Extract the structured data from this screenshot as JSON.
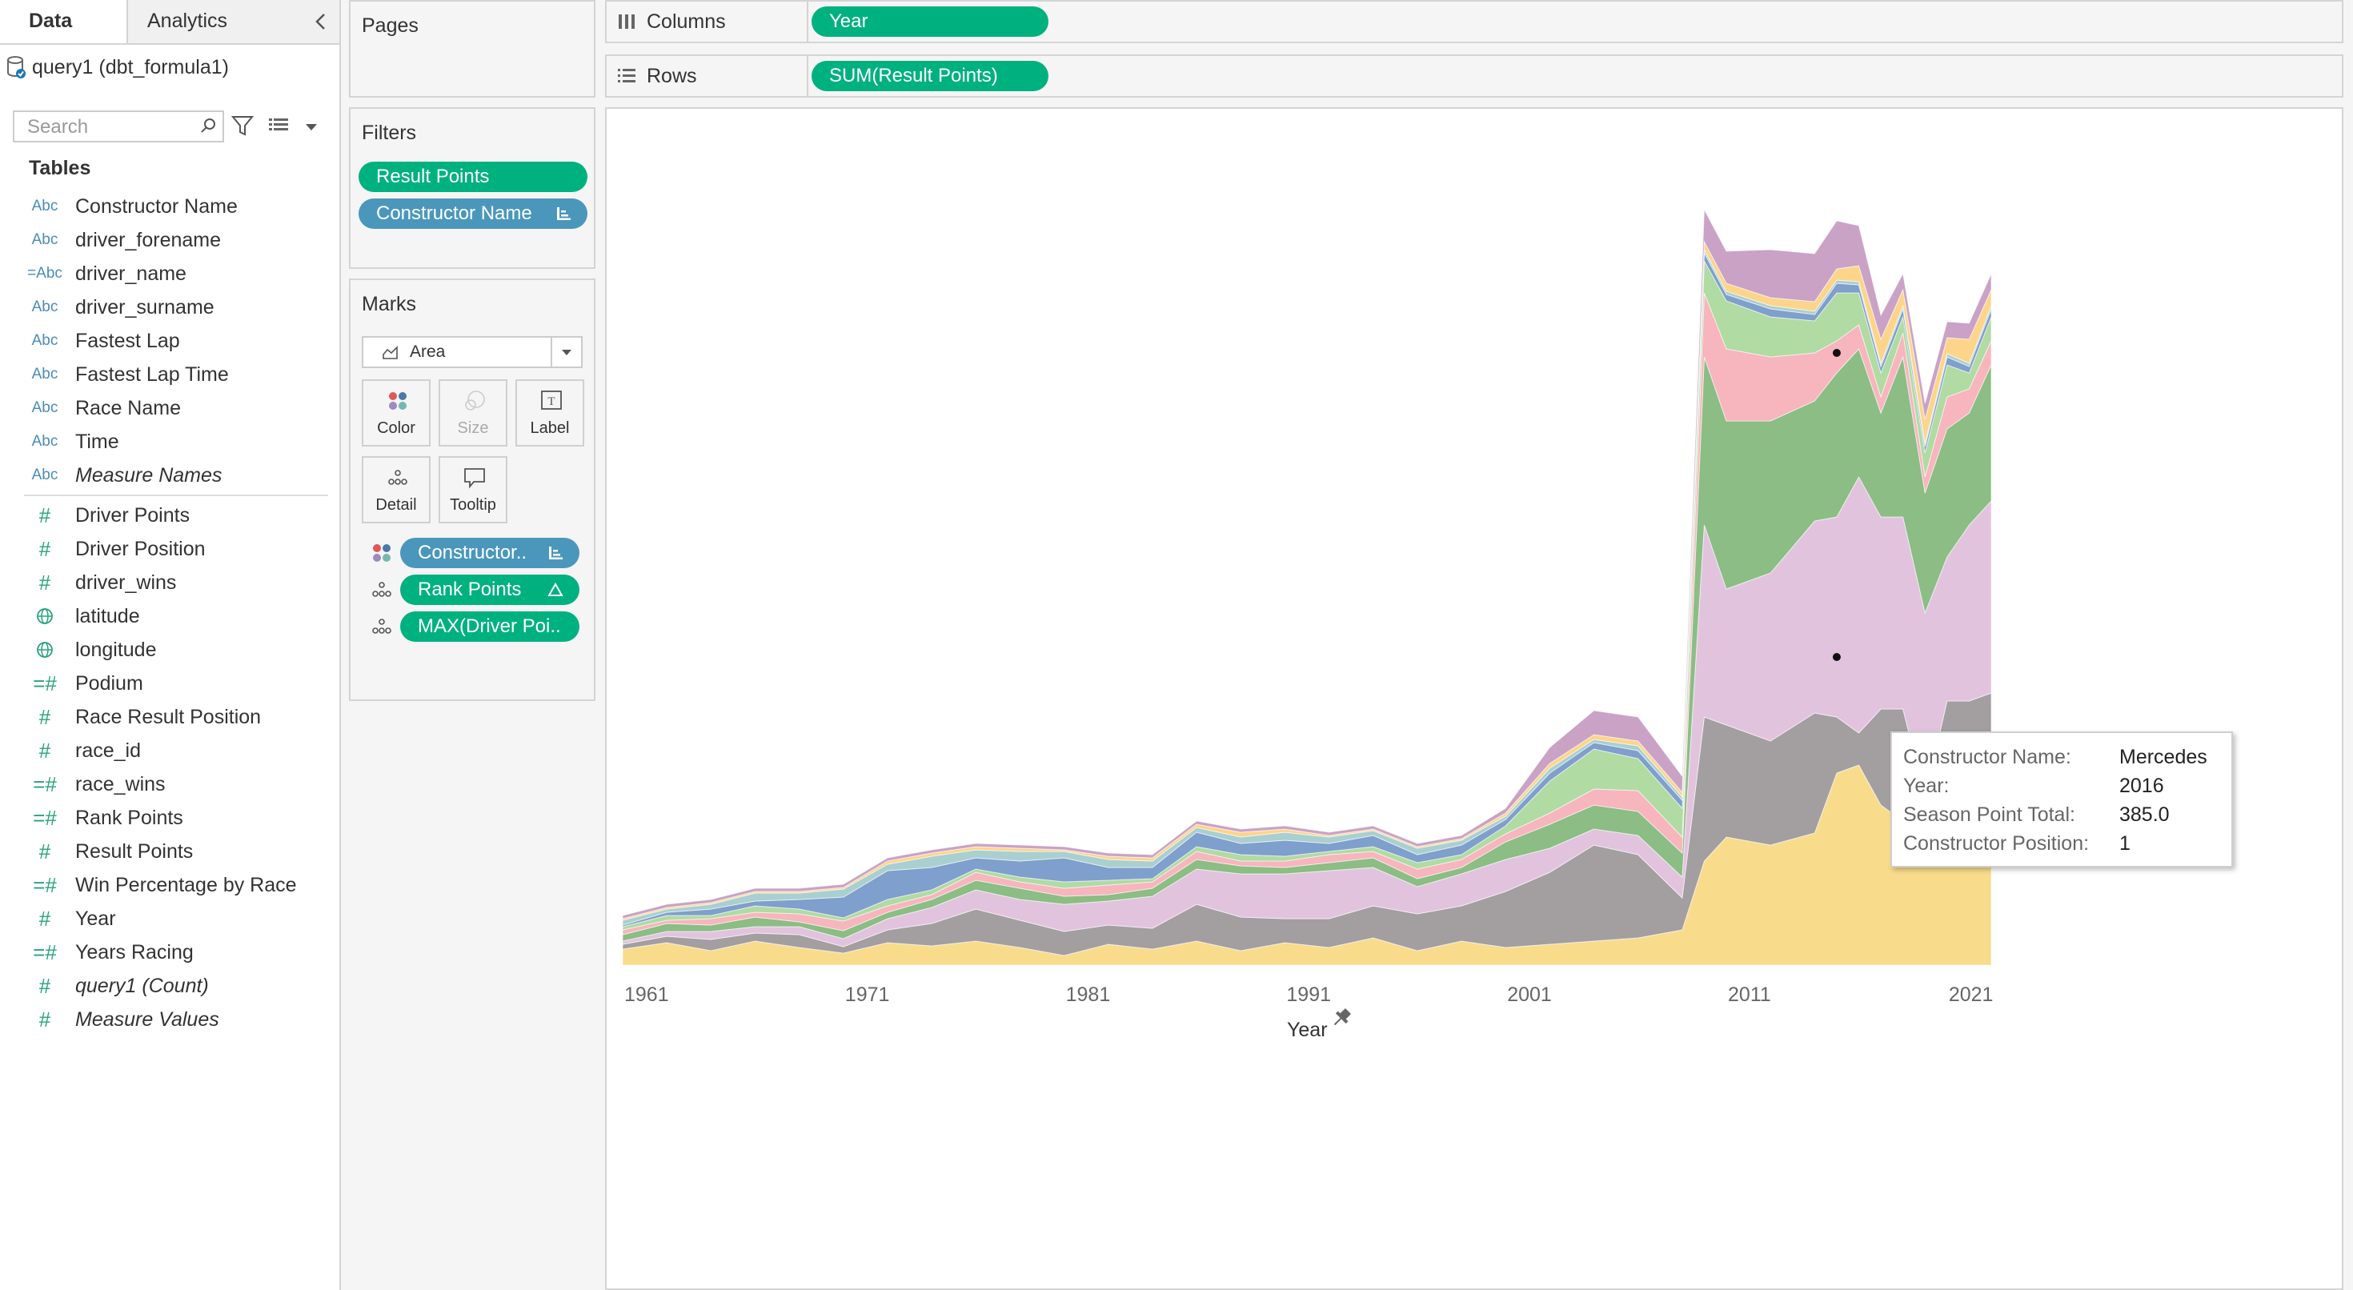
{
  "data_pane": {
    "tabs": [
      "Data",
      "Analytics"
    ],
    "datasource": "query1 (dbt_formula1)",
    "search_placeholder": "Search",
    "tables_label": "Tables",
    "fields": [
      {
        "icon": "Abc",
        "type": "dimension",
        "name": "Constructor Name"
      },
      {
        "icon": "Abc",
        "type": "dimension",
        "name": "driver_forename"
      },
      {
        "icon": "=Abc",
        "type": "dimension",
        "name": "driver_name"
      },
      {
        "icon": "Abc",
        "type": "dimension",
        "name": "driver_surname"
      },
      {
        "icon": "Abc",
        "type": "dimension",
        "name": "Fastest Lap"
      },
      {
        "icon": "Abc",
        "type": "dimension",
        "name": "Fastest Lap Time"
      },
      {
        "icon": "Abc",
        "type": "dimension",
        "name": "Race Name"
      },
      {
        "icon": "Abc",
        "type": "dimension",
        "name": "Time"
      },
      {
        "icon": "Abc",
        "type": "dimension",
        "name": "Measure Names",
        "italic": true
      },
      {
        "icon": "#",
        "type": "measure",
        "name": "Driver Points"
      },
      {
        "icon": "#",
        "type": "measure",
        "name": "Driver Position"
      },
      {
        "icon": "#",
        "type": "measure",
        "name": "driver_wins"
      },
      {
        "icon": "globe",
        "type": "geo",
        "name": "latitude"
      },
      {
        "icon": "globe",
        "type": "geo",
        "name": "longitude"
      },
      {
        "icon": "=#",
        "type": "measure",
        "name": "Podium"
      },
      {
        "icon": "#",
        "type": "measure",
        "name": "Race Result Position"
      },
      {
        "icon": "#",
        "type": "measure",
        "name": "race_id"
      },
      {
        "icon": "=#",
        "type": "measure",
        "name": "race_wins"
      },
      {
        "icon": "=#",
        "type": "measure",
        "name": "Rank Points"
      },
      {
        "icon": "#",
        "type": "measure",
        "name": "Result Points"
      },
      {
        "icon": "=#",
        "type": "measure",
        "name": "Win Percentage by Race"
      },
      {
        "icon": "#",
        "type": "measure",
        "name": "Year"
      },
      {
        "icon": "=#",
        "type": "measure",
        "name": "Years Racing"
      },
      {
        "icon": "#",
        "type": "measure",
        "name": "query1 (Count)",
        "italic": true
      },
      {
        "icon": "#",
        "type": "measure",
        "name": "Measure Values",
        "italic": true
      }
    ]
  },
  "pages_card": {
    "title": "Pages"
  },
  "filters_card": {
    "title": "Filters",
    "pills": [
      {
        "label": "Result Points",
        "color": "green"
      },
      {
        "label": "Constructor Name",
        "color": "blue",
        "sorted": true
      }
    ]
  },
  "marks_card": {
    "title": "Marks",
    "mark_type": "Area",
    "buttons": [
      {
        "label": "Color",
        "icon": "color-icon",
        "enabled": true
      },
      {
        "label": "Size",
        "icon": "size-icon",
        "enabled": false
      },
      {
        "label": "Label",
        "icon": "label-icon",
        "enabled": true
      },
      {
        "label": "Detail",
        "icon": "detail-icon",
        "enabled": true
      },
      {
        "label": "Tooltip",
        "icon": "tooltip-icon",
        "enabled": true
      }
    ],
    "encodings": [
      {
        "kind": "color",
        "label": "Constructor..",
        "color": "blue",
        "badge": "sort"
      },
      {
        "kind": "detail",
        "label": "Rank Points",
        "color": "green",
        "badge": "delta"
      },
      {
        "kind": "detail",
        "label": "MAX(Driver Poi..",
        "color": "green"
      }
    ]
  },
  "columns_shelf": {
    "label": "Columns",
    "pill": "Year"
  },
  "rows_shelf": {
    "label": "Rows",
    "pill": "SUM(Result Points)"
  },
  "chart_data": {
    "type": "area",
    "stacked": true,
    "x_axis": {
      "title": "Year",
      "ticks": [
        "1961",
        "1971",
        "1981",
        "1991",
        "2001",
        "2011",
        "2021"
      ],
      "range": [
        1961,
        2023
      ]
    },
    "x": [
      1961,
      1963,
      1965,
      1967,
      1969,
      1971,
      1973,
      1975,
      1977,
      1979,
      1981,
      1983,
      1985,
      1987,
      1989,
      1991,
      1993,
      1995,
      1997,
      1999,
      2001,
      2003,
      2005,
      2007,
      2009,
      2010,
      2011,
      2013,
      2015,
      2016,
      2017,
      2018,
      2019,
      2020,
      2021,
      2022,
      2023
    ],
    "series": [
      {
        "color": "#f8dc8c",
        "values": [
          20,
          28,
          18,
          30,
          22,
          15,
          28,
          24,
          30,
          22,
          12,
          26,
          20,
          30,
          18,
          28,
          22,
          34,
          18,
          30,
          22,
          26,
          30,
          34,
          44,
          130,
          160,
          150,
          165,
          240,
          250,
          200,
          180,
          170,
          190,
          210,
          230
        ]
      },
      {
        "color": "#a39ea0",
        "values": [
          6,
          8,
          14,
          10,
          16,
          8,
          16,
          28,
          40,
          34,
          30,
          24,
          26,
          46,
          42,
          30,
          36,
          40,
          46,
          44,
          70,
          90,
          120,
          104,
          40,
          180,
          140,
          130,
          150,
          70,
          40,
          120,
          140,
          40,
          140,
          120,
          110
        ]
      },
      {
        "color": "#e2c3de",
        "values": [
          4,
          6,
          10,
          8,
          10,
          10,
          14,
          20,
          24,
          26,
          34,
          30,
          40,
          44,
          54,
          56,
          60,
          48,
          34,
          40,
          40,
          30,
          20,
          24,
          26,
          240,
          170,
          210,
          240,
          250,
          320,
          240,
          240,
          230,
          180,
          220,
          240
        ]
      },
      {
        "color": "#8bbd84",
        "values": [
          8,
          10,
          8,
          12,
          6,
          10,
          8,
          10,
          12,
          14,
          10,
          8,
          10,
          12,
          10,
          8,
          10,
          12,
          10,
          8,
          22,
          30,
          30,
          30,
          30,
          210,
          210,
          190,
          150,
          180,
          160,
          130,
          200,
          150,
          160,
          140,
          170
        ]
      },
      {
        "color": "#f7b5bd",
        "values": [
          6,
          4,
          8,
          6,
          10,
          12,
          8,
          6,
          10,
          8,
          10,
          12,
          8,
          10,
          6,
          8,
          10,
          8,
          12,
          10,
          10,
          14,
          20,
          26,
          20,
          80,
          90,
          80,
          60,
          40,
          30,
          20,
          30,
          20,
          40,
          30,
          30
        ]
      },
      {
        "color": "#b0dba3",
        "values": [
          4,
          6,
          4,
          8,
          6,
          4,
          8,
          6,
          4,
          6,
          8,
          6,
          4,
          6,
          8,
          6,
          4,
          6,
          8,
          6,
          10,
          40,
          50,
          40,
          36,
          40,
          60,
          50,
          40,
          60,
          40,
          30,
          20,
          30,
          40,
          20,
          30
        ]
      },
      {
        "color": "#7f9fcc",
        "values": [
          2,
          4,
          8,
          6,
          12,
          26,
          36,
          28,
          14,
          20,
          30,
          16,
          14,
          18,
          14,
          20,
          10,
          14,
          10,
          12,
          8,
          10,
          8,
          10,
          10,
          10,
          8,
          10,
          8,
          12,
          10,
          8,
          10,
          8,
          10,
          8,
          10
        ]
      },
      {
        "color": "#aacfd0",
        "values": [
          6,
          4,
          6,
          10,
          8,
          10,
          8,
          14,
          10,
          12,
          8,
          10,
          8,
          6,
          8,
          10,
          8,
          6,
          8,
          6,
          4,
          6,
          4,
          6,
          4,
          4,
          4,
          4,
          4,
          4,
          4,
          4,
          4,
          4,
          4,
          4,
          4
        ]
      },
      {
        "color": "#fcd58b",
        "values": [
          2,
          2,
          2,
          2,
          2,
          2,
          4,
          4,
          4,
          4,
          2,
          4,
          4,
          4,
          6,
          4,
          2,
          2,
          2,
          2,
          4,
          6,
          6,
          6,
          6,
          10,
          10,
          10,
          12,
          14,
          20,
          30,
          20,
          30,
          20,
          30,
          20
        ]
      },
      {
        "color": "#c9a2c6",
        "values": [
          4,
          4,
          4,
          4,
          4,
          4,
          4,
          4,
          4,
          4,
          4,
          4,
          4,
          4,
          4,
          4,
          4,
          4,
          4,
          4,
          6,
          20,
          30,
          30,
          20,
          40,
          40,
          60,
          60,
          60,
          50,
          30,
          20,
          20,
          20,
          20,
          20
        ]
      }
    ],
    "y_max": 1000,
    "highlight_points": [
      {
        "x": 2016,
        "y": 385
      },
      {
        "x": 2016,
        "y": 765
      }
    ],
    "tooltip": {
      "rows": [
        {
          "key": "Constructor Name:",
          "value": "Mercedes"
        },
        {
          "key": "Year:",
          "value": "2016"
        },
        {
          "key": "Season Point Total:",
          "value": "385.0"
        },
        {
          "key": "Constructor Position:",
          "value": "1"
        }
      ]
    }
  }
}
